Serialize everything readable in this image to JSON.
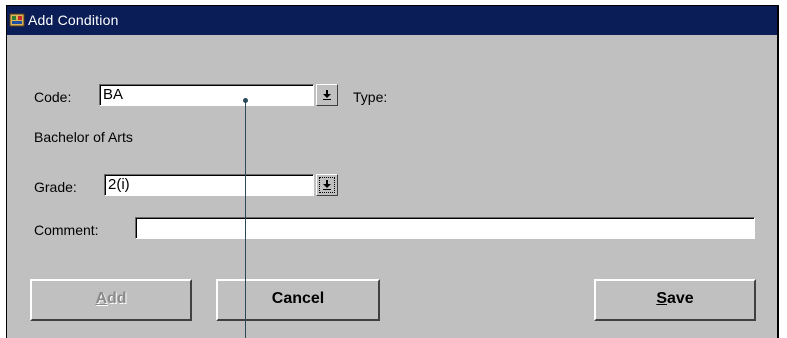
{
  "window": {
    "title": "Add Condition",
    "icon": "app-icon"
  },
  "form": {
    "code_label": "Code:",
    "code_value": "BA",
    "type_label": "Type:",
    "description": "Bachelor of Arts",
    "grade_label": "Grade:",
    "grade_value": "2(i)",
    "comment_label": "Comment:",
    "comment_value": ""
  },
  "buttons": {
    "add": {
      "mnemonic": "A",
      "rest": "dd",
      "enabled": false
    },
    "cancel": {
      "label": "Cancel"
    },
    "save": {
      "mnemonic": "S",
      "rest": "ave"
    }
  },
  "icons": {
    "lov": "dropdown-arrow-icon"
  },
  "colors": {
    "titlebar": "#0a1d57",
    "window_bg": "#c0c0c0",
    "field_bg": "#ffffff",
    "pointer_line": "#2a4a5a"
  }
}
